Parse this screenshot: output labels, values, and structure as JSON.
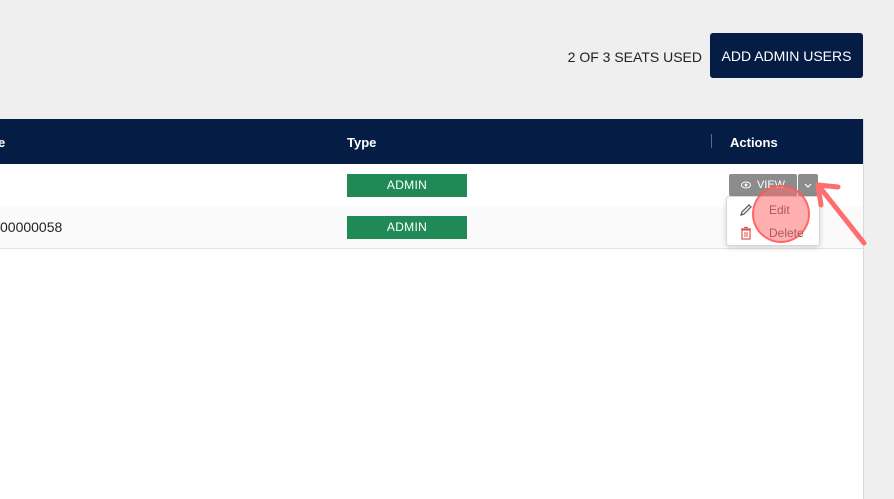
{
  "seats": {
    "text": "2 OF 3 SEATS USED"
  },
  "toolbar": {
    "add_label": "ADD ADMIN USERS"
  },
  "table": {
    "headers": {
      "name": "e",
      "type": "Type",
      "actions": "Actions"
    },
    "rows": [
      {
        "name": "",
        "type": "ADMIN",
        "view_label": "VIEW"
      },
      {
        "name": "00000058",
        "type": "ADMIN"
      }
    ]
  },
  "menu": {
    "edit_label": "Edit",
    "delete_label": "Delete"
  },
  "colors": {
    "navy": "#051d45",
    "admin_badge": "#1f8a55",
    "view_button": "#8c8c8c",
    "highlight": "#ff6e6e",
    "delete_icon": "#e05252"
  },
  "icons": {
    "view": "eye-icon",
    "dropdown": "chevron-down-icon",
    "edit": "pencil-icon",
    "delete": "trash-icon"
  }
}
